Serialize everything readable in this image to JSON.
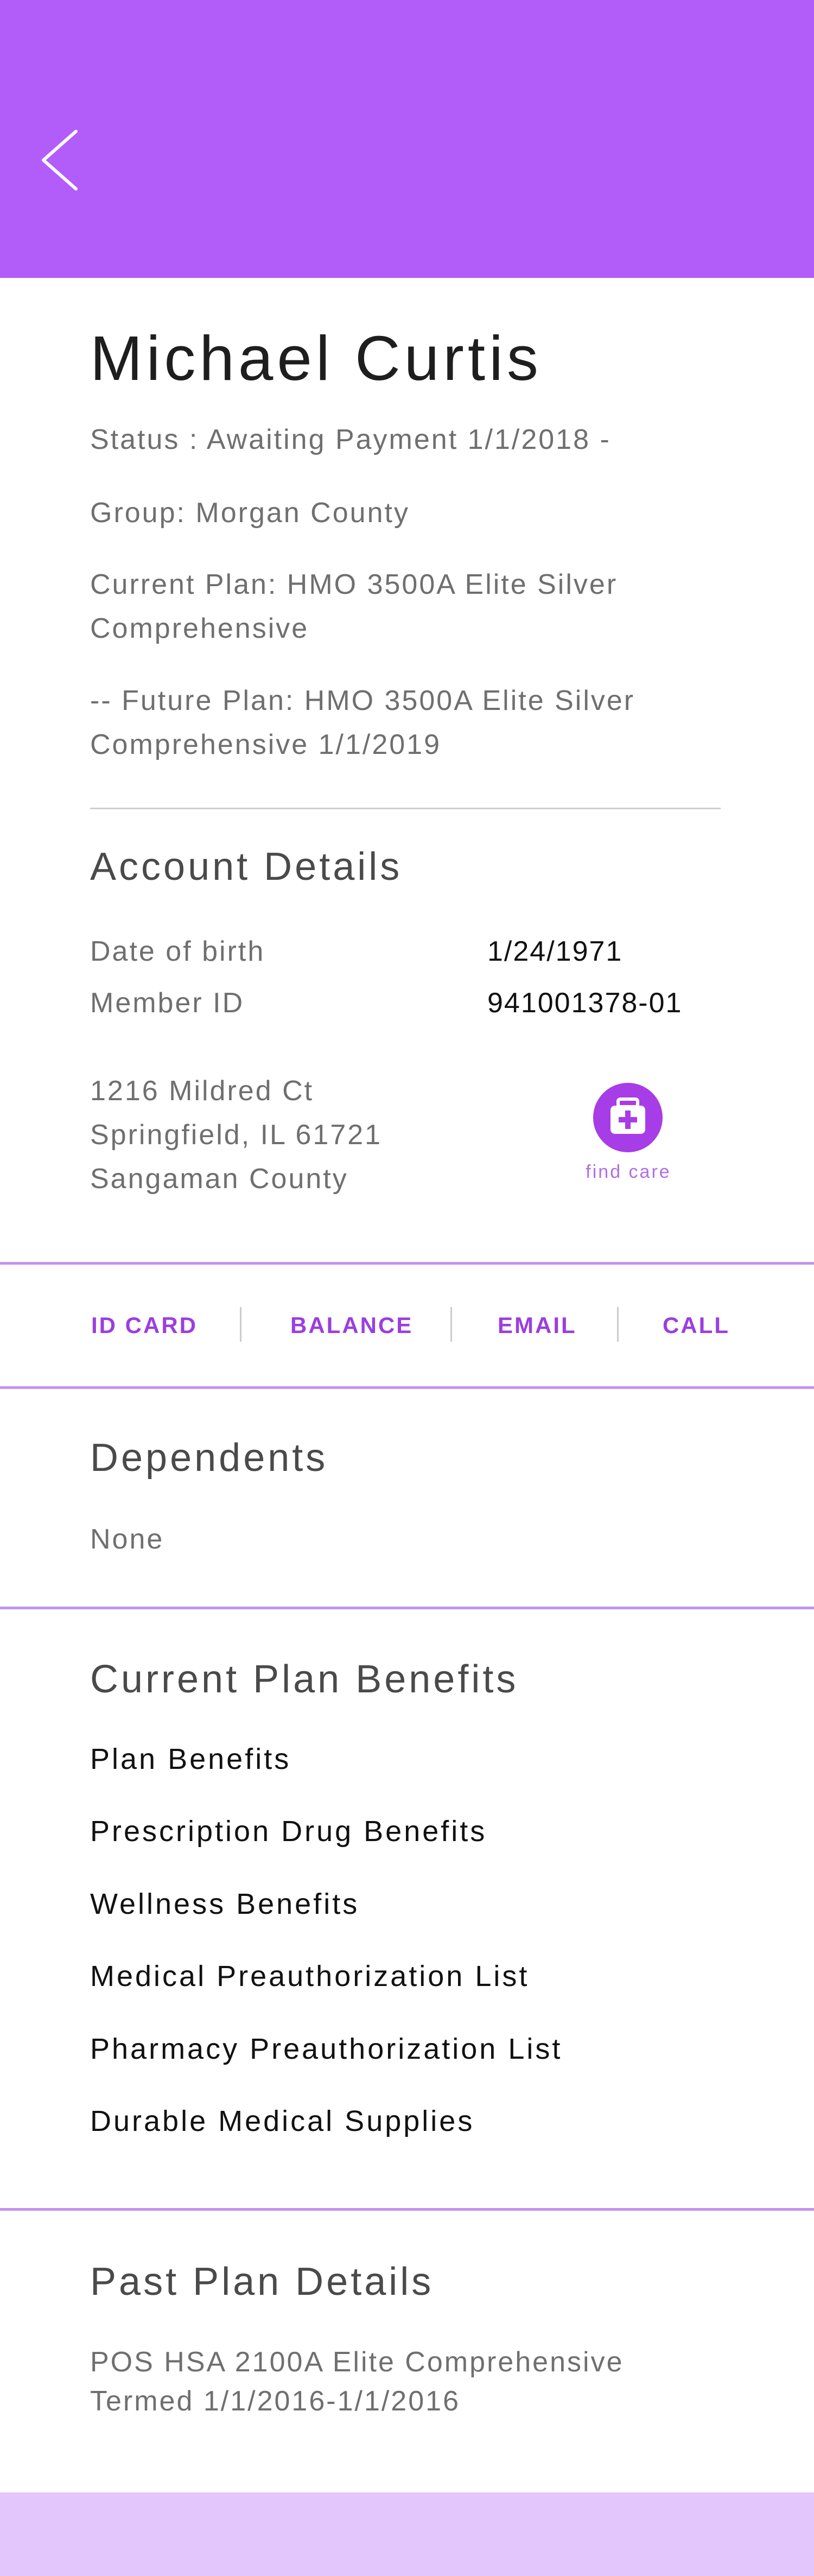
{
  "profile": {
    "name": "Michael Curtis",
    "status": "Status : Awaiting Payment 1/1/2018 -",
    "group": "Group: Morgan County",
    "current_plan": "Current Plan: HMO 3500A Elite Silver Comprehensive",
    "future_plan": "-- Future Plan: HMO 3500A Elite Silver Comprehensive 1/1/2019"
  },
  "account": {
    "heading": "Account Details",
    "dob_label": "Date of birth",
    "dob_value": "1/24/1971",
    "member_label": "Member ID",
    "member_value": "941001378-01",
    "address": [
      "1216 Mildred Ct",
      "Springfield, IL 61721",
      "Sangaman County"
    ],
    "find_care_label": "find care",
    "find_care_icon": "medical-kit-icon"
  },
  "actions": [
    "ID CARD",
    "BALANCE",
    "EMAIL",
    "CALL"
  ],
  "dependents": {
    "heading": "Dependents",
    "value": "None"
  },
  "benefits": {
    "heading": "Current Plan Benefits",
    "items": [
      "Plan Benefits",
      "Prescription Drug Benefits",
      "Wellness Benefits",
      "Medical Preauthorization List",
      "Pharmacy Preauthorization List",
      "Durable Medical Supplies"
    ]
  },
  "past_plan": {
    "heading": "Past Plan Details",
    "lines": [
      "POS HSA 2100A Elite Comprehensive",
      "Termed 1/1/2016-1/1/2016"
    ]
  },
  "colors": {
    "header": "#b25cfa",
    "accent": "#a73de6",
    "divider": "#c493ef",
    "footer": "#e3c6fb"
  }
}
